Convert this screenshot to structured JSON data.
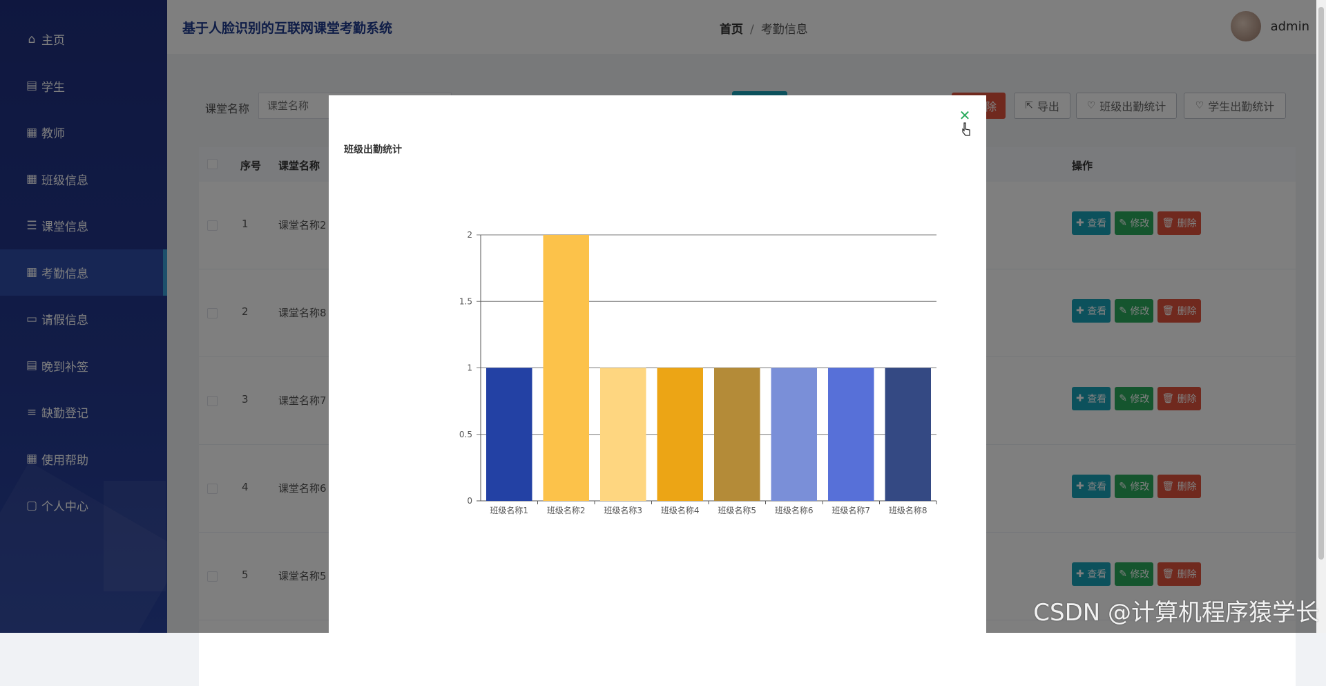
{
  "app": {
    "title": "基于人脸识别的互联网课堂考勤系统"
  },
  "breadcrumb": {
    "home": "首页",
    "separator": "/",
    "current": "考勤信息"
  },
  "user": {
    "name": "admin"
  },
  "sidebar": {
    "items": [
      {
        "label": "主页",
        "icon": "home-icon"
      },
      {
        "label": "学生",
        "icon": "clipboard-icon"
      },
      {
        "label": "教师",
        "icon": "grid-icon"
      },
      {
        "label": "班级信息",
        "icon": "grid-icon"
      },
      {
        "label": "课堂信息",
        "icon": "sliders-icon"
      },
      {
        "label": "考勤信息",
        "icon": "grid-icon",
        "active": true
      },
      {
        "label": "请假信息",
        "icon": "monitor-icon"
      },
      {
        "label": "晚到补签",
        "icon": "clipboard-icon"
      },
      {
        "label": "缺勤登记",
        "icon": "list-icon"
      },
      {
        "label": "使用帮助",
        "icon": "grid-icon"
      },
      {
        "label": "个人中心",
        "icon": "id-card-icon"
      }
    ]
  },
  "search": {
    "label": "课堂名称",
    "placeholder": "课堂名称"
  },
  "toolbar": {
    "delete_label": "除",
    "export_label": "导出",
    "class_stats_label": "班级出勤统计",
    "student_stats_label": "学生出勤统计"
  },
  "table": {
    "headers": {
      "index": "序号",
      "course": "课堂名称",
      "actions": "操作"
    },
    "rows": [
      {
        "index": "1",
        "course": "课堂名称2"
      },
      {
        "index": "2",
        "course": "课堂名称8"
      },
      {
        "index": "3",
        "course": "课堂名称7"
      },
      {
        "index": "4",
        "course": "课堂名称6"
      },
      {
        "index": "5",
        "course": "课堂名称5"
      }
    ],
    "actions": {
      "view": "查看",
      "edit": "修改",
      "delete": "删除"
    }
  },
  "modal": {
    "subtitle": "班级出勤统计"
  },
  "chart_data": {
    "type": "bar",
    "title": "",
    "categories": [
      "班级名称1",
      "班级名称2",
      "班级名称3",
      "班级名称4",
      "班级名称5",
      "班级名称6",
      "班级名称7",
      "班级名称8"
    ],
    "values": [
      1,
      2,
      1,
      1,
      1,
      1,
      1,
      1
    ],
    "colors": [
      "#2341a4",
      "#fcc24a",
      "#fed680",
      "#eca515",
      "#b48b38",
      "#7a8fd8",
      "#5770d8",
      "#344983"
    ],
    "ylim": [
      0,
      2
    ],
    "yticks": [
      "0",
      "0.5",
      "1",
      "1.5",
      "2"
    ],
    "grid": true
  },
  "watermark": "CSDN @计算机程序猿学长"
}
